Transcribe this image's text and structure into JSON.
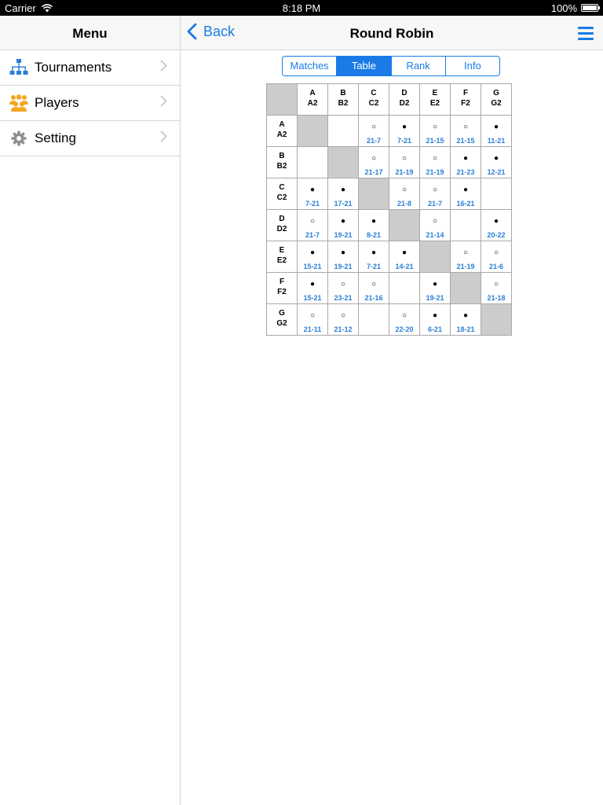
{
  "status": {
    "carrier": "Carrier",
    "time": "8:18 PM",
    "battery": "100%"
  },
  "sidebar": {
    "title": "Menu",
    "items": [
      {
        "label": "Tournaments",
        "icon": "tournament-bracket-icon"
      },
      {
        "label": "Players",
        "icon": "players-group-icon"
      },
      {
        "label": "Setting",
        "icon": "gear-icon"
      }
    ]
  },
  "nav": {
    "back": "Back",
    "title": "Round Robin"
  },
  "segments": [
    "Matches",
    "Table",
    "Rank",
    "Info"
  ],
  "active_segment": "Table",
  "colors": {
    "accent": "#1a7be6",
    "score": "#2a7fd4",
    "diagonal": "#cccccc"
  },
  "table": {
    "players": [
      {
        "top": "A",
        "bottom": "A2"
      },
      {
        "top": "B",
        "bottom": "B2"
      },
      {
        "top": "C",
        "bottom": "C2"
      },
      {
        "top": "D",
        "bottom": "D2"
      },
      {
        "top": "E",
        "bottom": "E2"
      },
      {
        "top": "F",
        "bottom": "F2"
      },
      {
        "top": "G",
        "bottom": "G2"
      }
    ],
    "rows": [
      [
        null,
        {
          "mark": "",
          "score": ""
        },
        {
          "mark": "○",
          "score": "21-7"
        },
        {
          "mark": "●",
          "score": "7-21"
        },
        {
          "mark": "○",
          "score": "21-15"
        },
        {
          "mark": "○",
          "score": "21-15"
        },
        {
          "mark": "●",
          "score": "11-21"
        }
      ],
      [
        {
          "mark": "",
          "score": ""
        },
        null,
        {
          "mark": "○",
          "score": "21-17"
        },
        {
          "mark": "○",
          "score": "21-19"
        },
        {
          "mark": "○",
          "score": "21-19"
        },
        {
          "mark": "●",
          "score": "21-23"
        },
        {
          "mark": "●",
          "score": "12-21"
        }
      ],
      [
        {
          "mark": "●",
          "score": "7-21"
        },
        {
          "mark": "●",
          "score": "17-21"
        },
        null,
        {
          "mark": "○",
          "score": "21-8"
        },
        {
          "mark": "○",
          "score": "21-7"
        },
        {
          "mark": "●",
          "score": "16-21"
        },
        {
          "mark": "",
          "score": ""
        }
      ],
      [
        {
          "mark": "○",
          "score": "21-7"
        },
        {
          "mark": "●",
          "score": "19-21"
        },
        {
          "mark": "●",
          "score": "8-21"
        },
        null,
        {
          "mark": "○",
          "score": "21-14"
        },
        {
          "mark": "",
          "score": ""
        },
        {
          "mark": "●",
          "score": "20-22"
        }
      ],
      [
        {
          "mark": "●",
          "score": "15-21"
        },
        {
          "mark": "●",
          "score": "19-21"
        },
        {
          "mark": "●",
          "score": "7-21"
        },
        {
          "mark": "●",
          "score": "14-21"
        },
        null,
        {
          "mark": "○",
          "score": "21-19"
        },
        {
          "mark": "○",
          "score": "21-6"
        }
      ],
      [
        {
          "mark": "●",
          "score": "15-21"
        },
        {
          "mark": "○",
          "score": "23-21"
        },
        {
          "mark": "○",
          "score": "21-16"
        },
        {
          "mark": "",
          "score": ""
        },
        {
          "mark": "●",
          "score": "19-21"
        },
        null,
        {
          "mark": "○",
          "score": "21-18"
        }
      ],
      [
        {
          "mark": "○",
          "score": "21-11"
        },
        {
          "mark": "○",
          "score": "21-12"
        },
        {
          "mark": "",
          "score": ""
        },
        {
          "mark": "○",
          "score": "22-20"
        },
        {
          "mark": "●",
          "score": "6-21"
        },
        {
          "mark": "●",
          "score": "18-21"
        },
        null
      ]
    ]
  }
}
